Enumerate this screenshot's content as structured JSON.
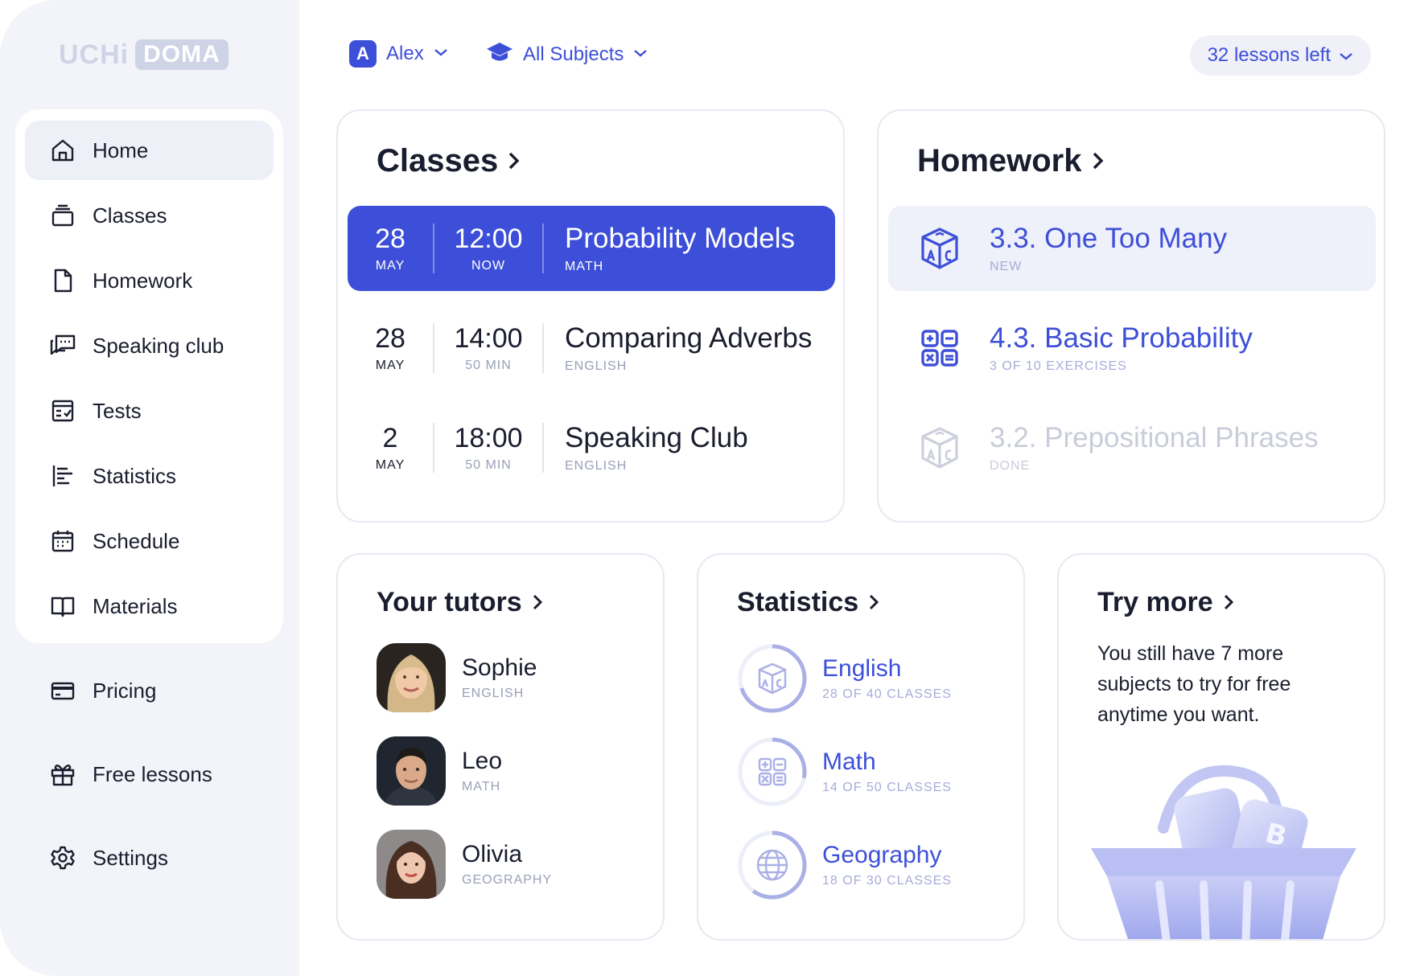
{
  "brand": {
    "logo_part1": "UCHi",
    "logo_part2": "DOMA"
  },
  "sidebar": {
    "items": [
      {
        "label": "Home",
        "icon": "home-icon"
      },
      {
        "label": "Classes",
        "icon": "classes-icon"
      },
      {
        "label": "Homework",
        "icon": "homework-icon"
      },
      {
        "label": "Speaking club",
        "icon": "speaking-club-icon"
      },
      {
        "label": "Tests",
        "icon": "tests-icon"
      },
      {
        "label": "Statistics",
        "icon": "statistics-icon"
      },
      {
        "label": "Schedule",
        "icon": "schedule-icon"
      },
      {
        "label": "Materials",
        "icon": "materials-icon"
      }
    ],
    "pricing": "Pricing",
    "free_lessons": "Free lessons",
    "settings": "Settings"
  },
  "topbar": {
    "user_initial": "A",
    "user_name": "Alex",
    "subjects": "All Subjects",
    "lessons_left": "32 lessons left"
  },
  "classes": {
    "title": "Classes",
    "rows": [
      {
        "day": "28",
        "month": "MAY",
        "time": "12:00",
        "duration": "NOW",
        "name": "Probability Models",
        "subject": "MATH"
      },
      {
        "day": "28",
        "month": "MAY",
        "time": "14:00",
        "duration": "50 MIN",
        "name": "Comparing Adverbs",
        "subject": "ENGLISH"
      },
      {
        "day": "2",
        "month": "MAY",
        "time": "18:00",
        "duration": "50 MIN",
        "name": "Speaking Club",
        "subject": "ENGLISH"
      }
    ]
  },
  "homework": {
    "title": "Homework",
    "rows": [
      {
        "name": "3.3. One Too Many",
        "status": "NEW"
      },
      {
        "name": "4.3. Basic Probability",
        "status": "3 OF 10 EXERCISES"
      },
      {
        "name": "3.2. Prepositional Phrases",
        "status": "DONE"
      }
    ]
  },
  "tutors": {
    "title": "Your tutors",
    "list": [
      {
        "name": "Sophie",
        "subject": "ENGLISH"
      },
      {
        "name": "Leo",
        "subject": "MATH"
      },
      {
        "name": "Olivia",
        "subject": "GEOGRAPHY"
      }
    ]
  },
  "statistics": {
    "title": "Statistics",
    "list": [
      {
        "name": "English",
        "progress": "28 OF 40 CLASSES",
        "done": 28,
        "total": 40
      },
      {
        "name": "Math",
        "progress": "14 OF 50 CLASSES",
        "done": 14,
        "total": 50
      },
      {
        "name": "Geography",
        "progress": "18 OF 30 CLASSES",
        "done": 18,
        "total": 30
      }
    ]
  },
  "try_more": {
    "title": "Try more",
    "text": "You still have 7 more subjects to try for free anytime you want."
  },
  "colors": {
    "accent": "#3d4fd8",
    "muted": "#9aa0b8",
    "border": "#e7e9f2"
  }
}
